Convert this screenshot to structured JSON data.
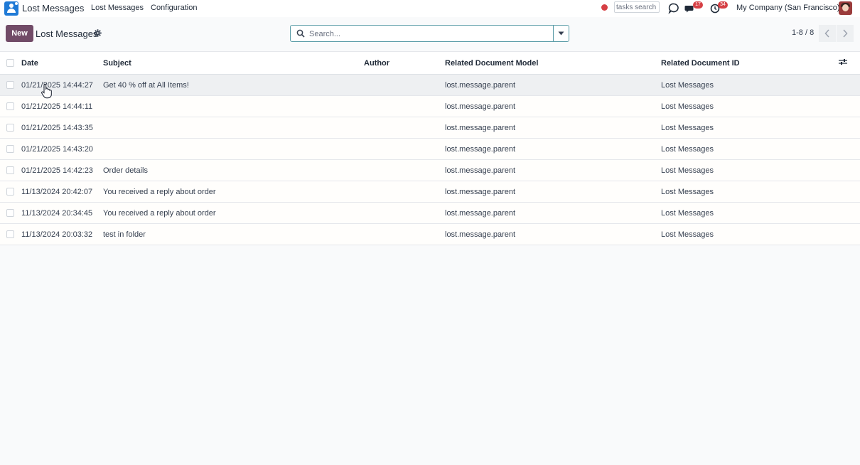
{
  "navbar": {
    "brand": "Lost Messages",
    "menu": [
      "Lost Messages",
      "Configuration"
    ],
    "tasks_search_placeholder": "tasks search",
    "messages_badge": "17",
    "activities_badge": "34",
    "company": "My Company (San Francisco)"
  },
  "control_panel": {
    "new_label": "New",
    "title": "Lost Messages",
    "search_placeholder": "Search...",
    "pager": "1-8 / 8"
  },
  "table": {
    "columns": [
      "Date",
      "Subject",
      "Author",
      "Related Document Model",
      "Related Document ID"
    ],
    "rows": [
      {
        "date": "01/21/2025 14:44:27",
        "subject": "Get 40 % off at All Items!",
        "author": "",
        "model": "lost.message.parent",
        "doc_id": "Lost Messages"
      },
      {
        "date": "01/21/2025 14:44:11",
        "subject": "",
        "author": "",
        "model": "lost.message.parent",
        "doc_id": "Lost Messages"
      },
      {
        "date": "01/21/2025 14:43:35",
        "subject": "",
        "author": "",
        "model": "lost.message.parent",
        "doc_id": "Lost Messages"
      },
      {
        "date": "01/21/2025 14:43:20",
        "subject": "",
        "author": "",
        "model": "lost.message.parent",
        "doc_id": "Lost Messages"
      },
      {
        "date": "01/21/2025 14:42:23",
        "subject": "Order details",
        "author": "",
        "model": "lost.message.parent",
        "doc_id": "Lost Messages"
      },
      {
        "date": "11/13/2024 20:42:07",
        "subject": "You received a reply about order",
        "author": "",
        "model": "lost.message.parent",
        "doc_id": "Lost Messages"
      },
      {
        "date": "11/13/2024 20:34:45",
        "subject": "You received a reply about order",
        "author": "",
        "model": "lost.message.parent",
        "doc_id": "Lost Messages"
      },
      {
        "date": "11/13/2024 20:03:32",
        "subject": "test in folder",
        "author": "",
        "model": "lost.message.parent",
        "doc_id": "Lost Messages"
      }
    ]
  },
  "colors": {
    "primary": "#714b67",
    "app_icon": "#1f7ad6",
    "badge": "#d64045",
    "search_border": "#5a9ca7"
  }
}
